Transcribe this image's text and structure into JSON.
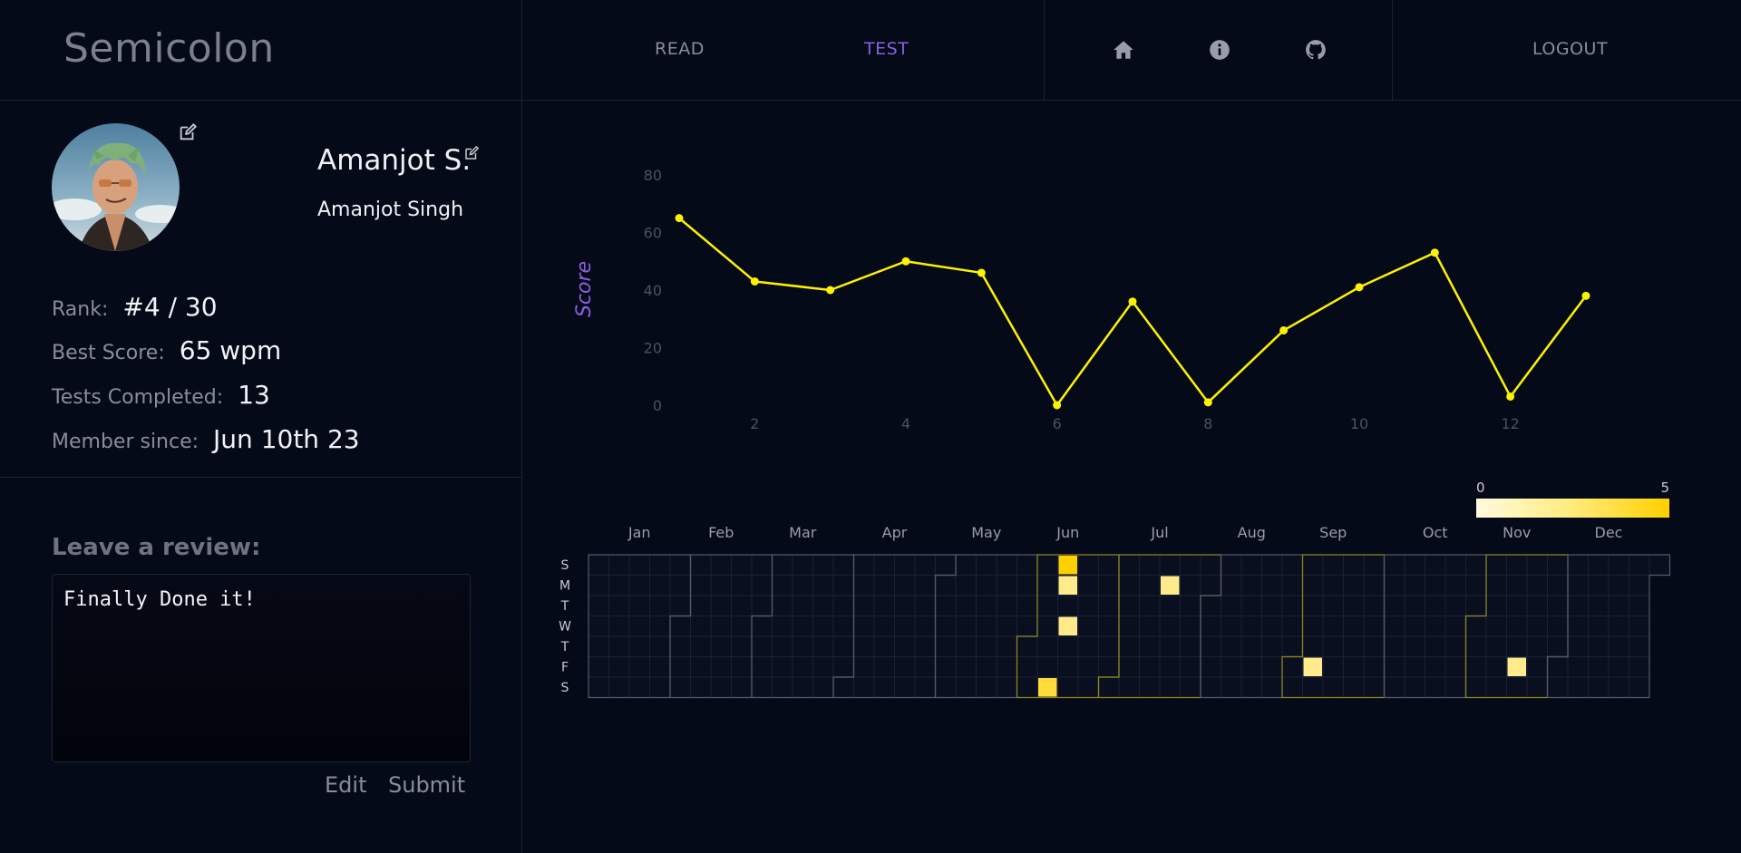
{
  "header": {
    "brand": "Semicolon",
    "nav": [
      {
        "label": "READ",
        "active": false
      },
      {
        "label": "TEST",
        "active": true
      }
    ],
    "icons": [
      "home-icon",
      "info-icon",
      "github-icon"
    ],
    "logout_label": "LOGOUT"
  },
  "profile": {
    "display_name": "Amanjot S.",
    "full_name": "Amanjot Singh",
    "stats": {
      "rank_label": "Rank:",
      "rank_value": "#4 / 30",
      "best_label": "Best Score:",
      "best_value": "65 wpm",
      "tests_label": "Tests Completed:",
      "tests_value": "13",
      "member_label": "Member since:",
      "member_value": "Jun 10th 23"
    }
  },
  "review": {
    "title": "Leave a review:",
    "text": "Finally Done it!",
    "edit_label": "Edit",
    "submit_label": "Submit"
  },
  "colors": {
    "accent": "#8b5fe0",
    "line": "#fff200",
    "background": "#050a18"
  },
  "chart_data": [
    {
      "type": "line",
      "ylabel": "Score",
      "x": [
        1,
        2,
        3,
        4,
        5,
        6,
        7,
        8,
        9,
        10,
        11,
        12,
        13
      ],
      "y": [
        65,
        43,
        40,
        50,
        46,
        0,
        36,
        1,
        26,
        41,
        53,
        3,
        38
      ],
      "xticks": [
        2,
        4,
        6,
        8,
        10,
        12
      ],
      "yticks": [
        0,
        20,
        40,
        60,
        80
      ],
      "ylim": [
        0,
        80
      ],
      "grid": false
    },
    {
      "type": "heatmap",
      "months": [
        "Jan",
        "Feb",
        "Mar",
        "Apr",
        "May",
        "Jun",
        "Jul",
        "Aug",
        "Sep",
        "Oct",
        "Nov",
        "Dec"
      ],
      "weekdays": [
        "S",
        "M",
        "T",
        "W",
        "T",
        "F",
        "S"
      ],
      "scale": {
        "min_label": "0",
        "max_label": "5",
        "min": 0,
        "max": 5
      },
      "year": 2023,
      "values": [
        {
          "date": "2023-06-10",
          "value": 3
        },
        {
          "date": "2023-06-11",
          "value": 5
        },
        {
          "date": "2023-06-12",
          "value": 1
        },
        {
          "date": "2023-06-14",
          "value": 1
        },
        {
          "date": "2023-07-17",
          "value": 1
        },
        {
          "date": "2023-09-08",
          "value": 1
        },
        {
          "date": "2023-11-17",
          "value": 1
        }
      ]
    }
  ]
}
